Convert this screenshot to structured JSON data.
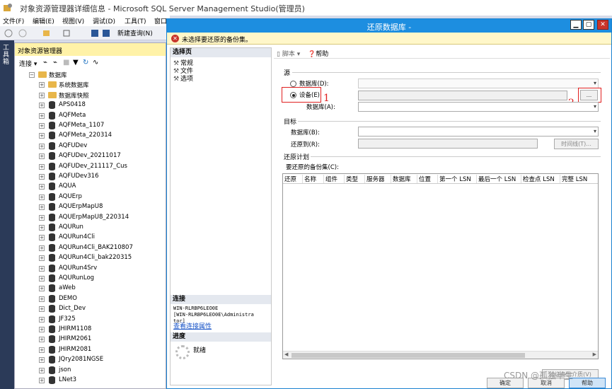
{
  "ssms": {
    "title": "对象资源管理器详细信息 - Microsoft SQL Server Management Studio(管理员)",
    "menu": [
      "文件(F)",
      "编辑(E)",
      "视图(V)",
      "调试(D)",
      "工具(T)",
      "窗口(W)"
    ],
    "new_query": "新建查询(N)",
    "side_tab": "工具箱"
  },
  "object_explorer": {
    "title": "对象资源管理器",
    "connect_label": "连接",
    "root": "数据库",
    "folders": [
      "系统数据库",
      "数据库快照"
    ],
    "databases": [
      "APS0418",
      "AQFMeta",
      "AQFMeta_1107",
      "AQFMeta_220314",
      "AQFUDev",
      "AQFUDev_20211017",
      "AQFUDev_211117_Cus",
      "AQFUDev316",
      "AQUA",
      "AQUErp",
      "AQUErpMapU8",
      "AQUErpMapU8_220314",
      "AQURun",
      "AQURun4Cli",
      "AQURun4Cli_BAK210807",
      "AQURun4Cli_bak220315",
      "AQURun4Srv",
      "AQURunLog",
      "aWeb",
      "DEMO",
      "Dict_Dev",
      "JF325",
      "JHIRM1108",
      "JHIRM2061",
      "JHIRM2081",
      "JQry2081NGSE",
      "json",
      "LNet3"
    ]
  },
  "dialog": {
    "title": "还原数据库 -",
    "error": "未选择要还原的备份集。",
    "select_page": "选择页",
    "pages": [
      "常规",
      "文件",
      "选项"
    ],
    "connection_head": "连接",
    "connection_info": "WIN-RLRBP6LEO0E\n[WIN-RLRBP6LEO0E\\Administra\ntor]",
    "view_connection": "查看连接属性",
    "progress_head": "进度",
    "progress_status": "就绪",
    "toolbar": {
      "script": "脚本",
      "help": "帮助"
    },
    "source": {
      "title": "源",
      "database_radio": "数据库(D):",
      "device_radio": "设备(E):",
      "device_database": "数据库(A):",
      "browse": "..."
    },
    "destination": {
      "title": "目标",
      "database": "数据库(B):",
      "restore_to": "还原到(R):",
      "timeline": "时间线(T)..."
    },
    "plan": {
      "title": "还原计划",
      "backup_sets": "要还原的备份集(C):",
      "columns": [
        "还原",
        "名称",
        "组件",
        "类型",
        "服务器",
        "数据库",
        "位置",
        "第一个 LSN",
        "最后一个 LSN",
        "检查点 LSN",
        "完整 LSN"
      ],
      "verify": "验证备份介质(V)"
    },
    "buttons": {
      "ok": "确定",
      "cancel": "取消",
      "help": "帮助"
    }
  },
  "annotations": [
    "1",
    "2"
  ],
  "watermark": "CSDN @孤独半生"
}
